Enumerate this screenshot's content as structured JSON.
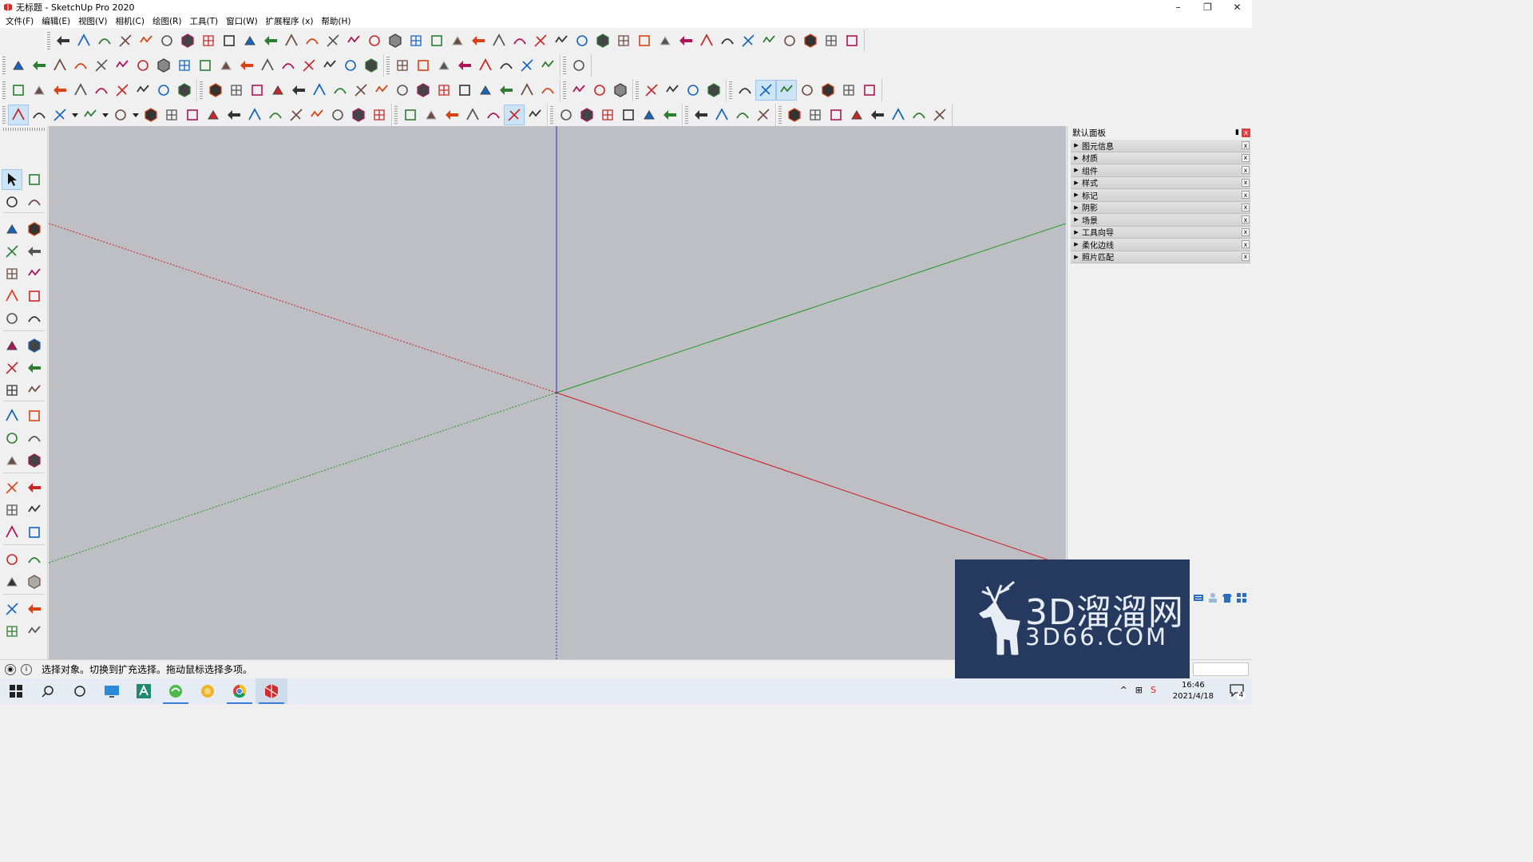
{
  "window": {
    "title": "无标题 - SketchUp Pro 2020",
    "minimize": "–",
    "restore": "❐",
    "close": "✕"
  },
  "menu": [
    "文件(F)",
    "编辑(E)",
    "视图(V)",
    "相机(C)",
    "绘图(R)",
    "工具(T)",
    "窗口(W)",
    "扩展程序 (x)",
    "帮助(H)"
  ],
  "tray": {
    "title": "默认面板",
    "pin": "📌",
    "close": "x",
    "items": [
      "图元信息",
      "材质",
      "组件",
      "样式",
      "标记",
      "阴影",
      "场景",
      "工具向导",
      "柔化边线",
      "照片匹配"
    ],
    "arrow": "▶",
    "item_close": "x"
  },
  "status": {
    "text": "选择对象。切换到扩充选择。拖动鼠标选择多项。",
    "info_icon": "i"
  },
  "watermark": {
    "main": "3D溜溜网",
    "sub": "3D66.COM"
  },
  "taskbar": {
    "time": "16:46",
    "date": "2021/4/18",
    "notification_count": "4"
  },
  "colors": {
    "axis_red": "#cc1b1b",
    "axis_green": "#1e9a1e",
    "axis_blue": "#2c2cb8",
    "viewport_bg": "#bebfc4",
    "watermark_bg": "#253a5e",
    "accent_red": "#d42a2a"
  }
}
